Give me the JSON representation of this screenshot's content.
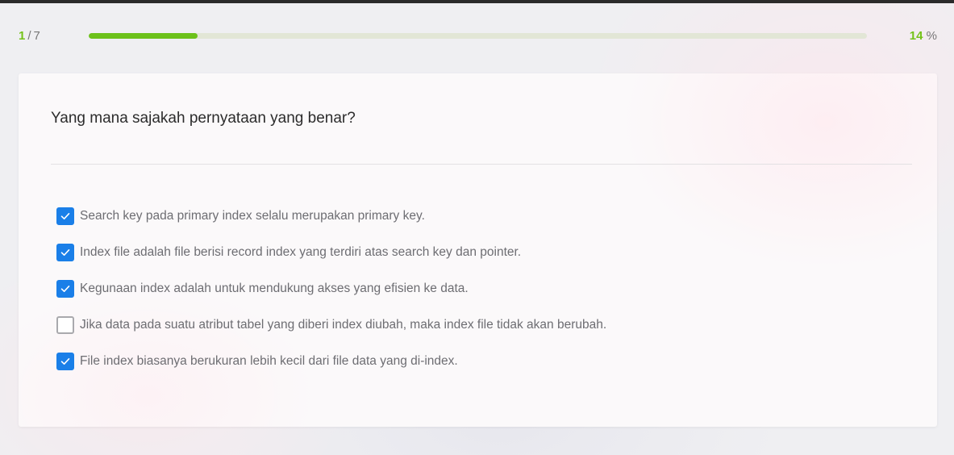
{
  "progress": {
    "current_step": "1",
    "separator": "/",
    "total_steps": "7",
    "percent_value": "14",
    "percent_symbol": "%",
    "fraction": 0.14,
    "fill_color": "#6cc11a",
    "accent_color": "#74c21a"
  },
  "question": {
    "text": "Yang mana sajakah pernyataan yang benar?"
  },
  "options": [
    {
      "label": "Search key pada primary index selalu merupakan primary key.",
      "checked": true
    },
    {
      "label": "Index file adalah file berisi record index yang terdiri atas search key dan pointer.",
      "checked": true
    },
    {
      "label": "Kegunaan index adalah untuk mendukung akses yang efisien ke data.",
      "checked": true
    },
    {
      "label": "Jika data pada suatu atribut tabel yang diberi index diubah, maka index file tidak akan berubah.",
      "checked": false
    },
    {
      "label": "File index biasanya berukuran lebih kecil dari file data yang di-index.",
      "checked": true
    }
  ],
  "icons": {
    "checked_box": "checkbox-checked-icon",
    "unchecked_box": "checkbox-unchecked-icon",
    "check_mark": "check-icon"
  },
  "colors": {
    "checkbox_checked": "#1a7fe8",
    "checkbox_unchecked_border": "#a9a9ad"
  }
}
